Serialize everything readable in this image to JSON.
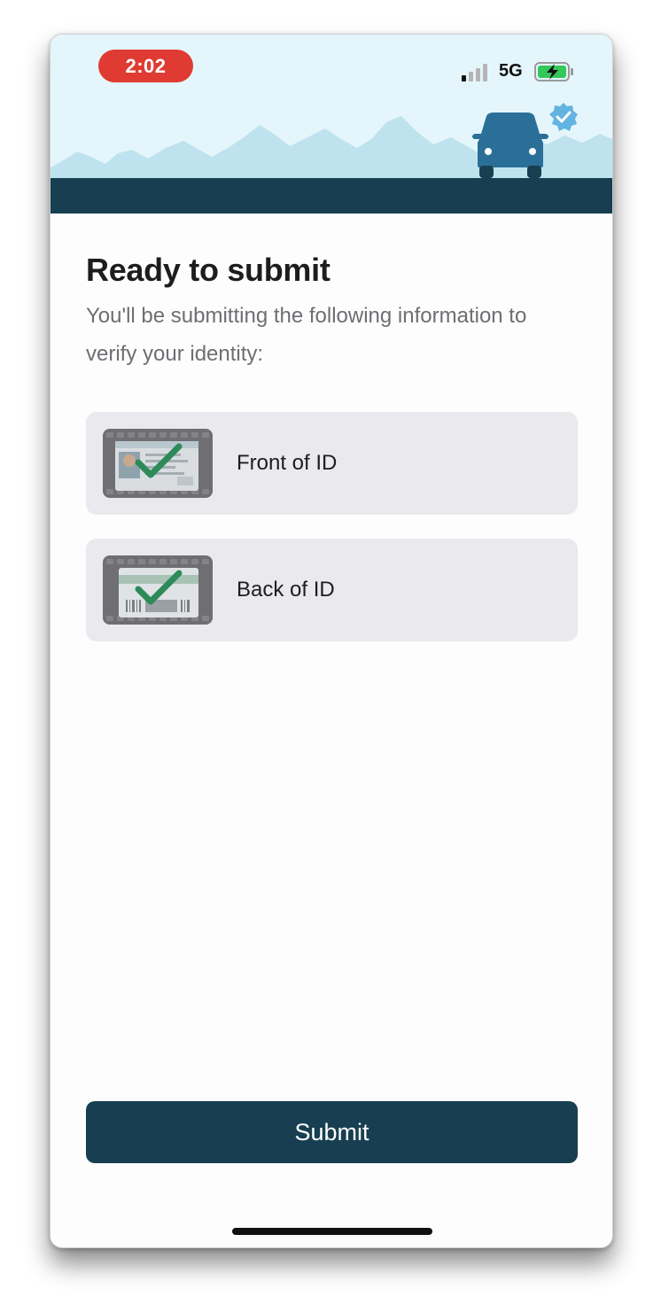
{
  "status_bar": {
    "time": "2:02",
    "network": "5G",
    "clock_color": "#df3b32"
  },
  "header": {
    "illustration": "mountains-road-car",
    "badge_icon": "verified-badge-icon",
    "sky_color": "#e4f6fb",
    "mountain_color": "#bfe3ee",
    "road_color": "#173f51",
    "car_color": "#2a6f97"
  },
  "page": {
    "title": "Ready to submit",
    "subtitle": "You'll be submitting the following information to verify your identity:"
  },
  "items": [
    {
      "label": "Front of ID",
      "icon": "id-front-check-icon"
    },
    {
      "label": "Back of ID",
      "icon": "id-back-check-icon"
    }
  ],
  "actions": {
    "submit_label": "Submit"
  },
  "colors": {
    "primary": "#173f51",
    "card_background": "#e9e9ee",
    "check_color": "#2f8a5a"
  }
}
